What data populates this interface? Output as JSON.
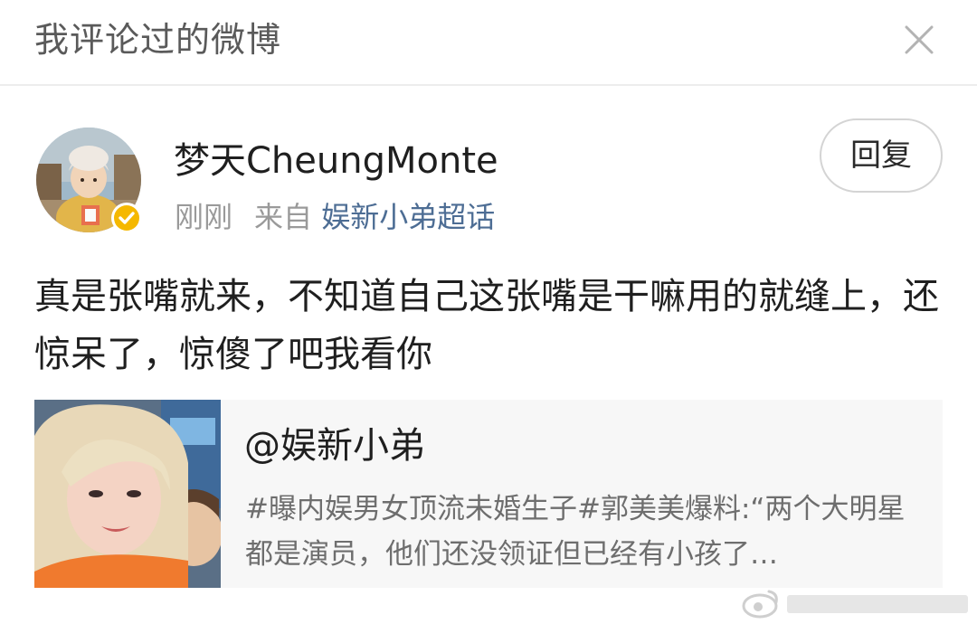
{
  "header": {
    "title": "我评论过的微博"
  },
  "post": {
    "username": "梦天CheungMonte",
    "time": "刚刚",
    "source_prefix": "来自",
    "source": "娱新小弟超话",
    "reply_label": "回复",
    "text": "真是张嘴就来，不知道自己这张嘴是干嘛用的就缝上，还惊呆了，惊傻了吧我看你"
  },
  "card": {
    "author": "@娱新小弟",
    "snippet": "#曝内娱男女顶流未婚生子#郭美美爆料:“两个大明星都是演员，他们还没领证但已经有小孩了…"
  },
  "icons": {
    "close": "close-icon",
    "verified": "verified-badge-icon",
    "watermark": "weibo-logo-icon"
  },
  "colors": {
    "link": "#4d6d94",
    "verified_badge": "#f5b800",
    "card_background": "#f7f7f7",
    "secondary_text": "#9a9a9a"
  }
}
